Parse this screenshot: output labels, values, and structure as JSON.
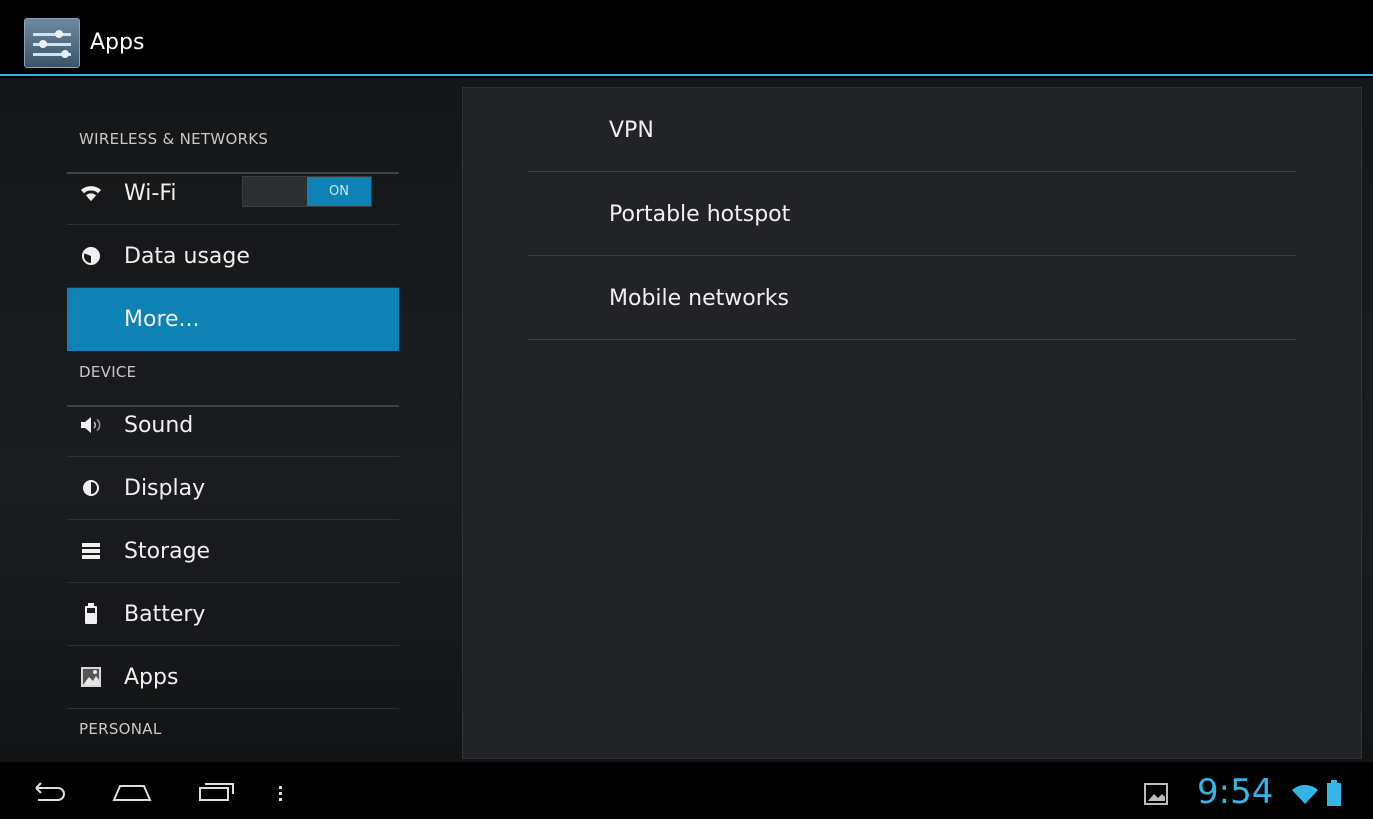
{
  "action_bar": {
    "title": "Apps",
    "icon": "settings-sliders-icon"
  },
  "left_pane": {
    "sections": [
      {
        "header": "WIRELESS & NETWORKS"
      },
      {
        "header": "DEVICE"
      },
      {
        "header": "PERSONAL"
      }
    ],
    "items": [
      {
        "label": "Wi-Fi",
        "icon": "wifi-icon",
        "toggle": "ON"
      },
      {
        "label": "Data usage",
        "icon": "data-usage-icon"
      },
      {
        "label": "More...",
        "selected": true
      },
      {
        "label": "Sound",
        "icon": "speaker-icon"
      },
      {
        "label": "Display",
        "icon": "brightness-icon"
      },
      {
        "label": "Storage",
        "icon": "storage-icon"
      },
      {
        "label": "Battery",
        "icon": "battery-icon"
      },
      {
        "label": "Apps",
        "icon": "apps-icon"
      }
    ]
  },
  "right_pane": {
    "items": [
      {
        "label": "VPN"
      },
      {
        "label": "Portable hotspot"
      },
      {
        "label": "Mobile networks"
      }
    ]
  },
  "system_bar": {
    "clock": "9:54",
    "nav_icons": [
      "back-icon",
      "home-icon",
      "recent-apps-icon",
      "menu-icon"
    ],
    "status_icons": [
      "gallery-icon",
      "wifi-signal-icon",
      "battery-status-icon"
    ]
  },
  "colors": {
    "accent": "#33b5e5",
    "selected": "#0e82b5"
  }
}
